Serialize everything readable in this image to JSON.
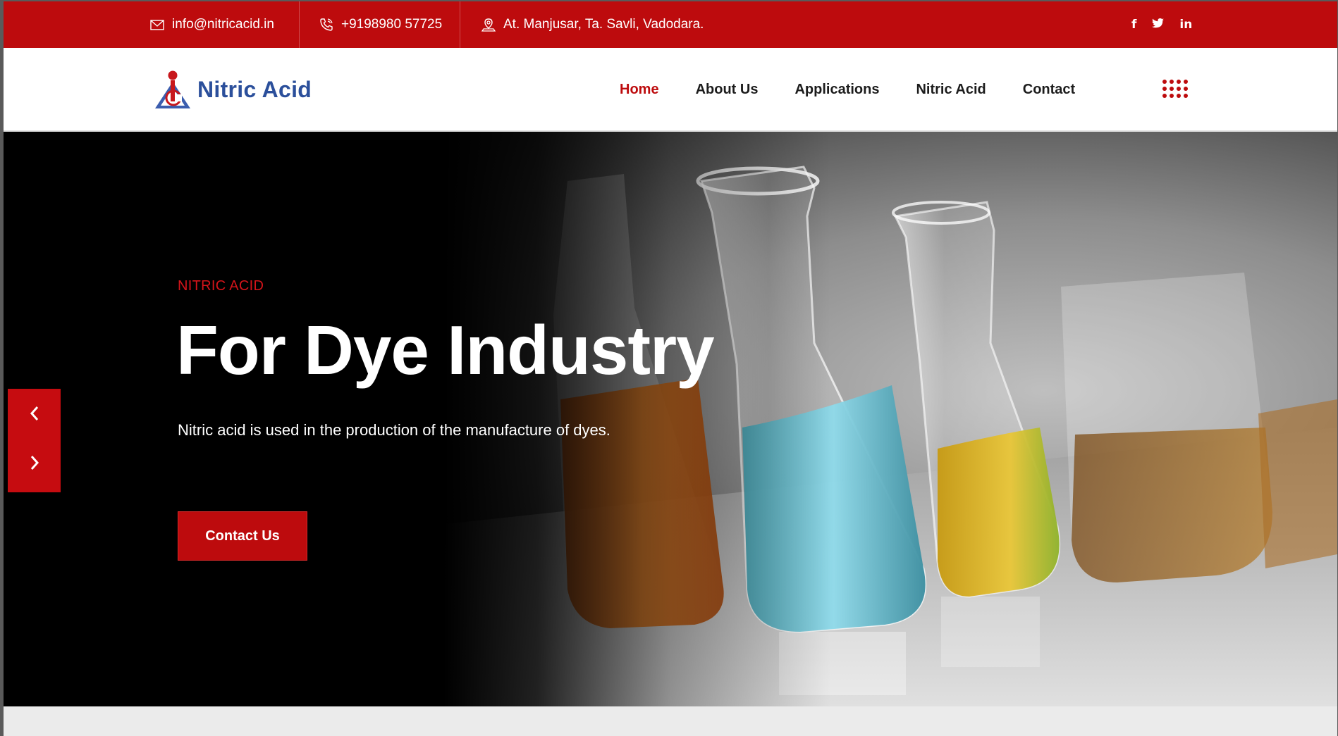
{
  "topbar": {
    "email": "info@nitricacid.in",
    "phone": "+9198980 57725",
    "address": "At. Manjusar, Ta. Savli, Vadodara.",
    "social": [
      {
        "icon": "facebook-icon",
        "glyph": "f"
      },
      {
        "icon": "twitter-icon",
        "glyph": "t"
      },
      {
        "icon": "linkedin-icon",
        "glyph": "in"
      }
    ]
  },
  "header": {
    "logo_text": "Nitric Acid",
    "nav": {
      "home": "Home",
      "about": "About Us",
      "applications": "Applications",
      "nitric": "Nitric Acid",
      "contact": "Contact"
    },
    "active_item": "Home"
  },
  "hero": {
    "kicker": "NITRIC ACID",
    "title": "For Dye Industry",
    "description": "Nitric acid is used in the production of the manufacture of dyes.",
    "button": "Contact Us"
  },
  "colors": {
    "brand_red": "#bd0b0d",
    "logo_blue": "#2b4f9b"
  }
}
